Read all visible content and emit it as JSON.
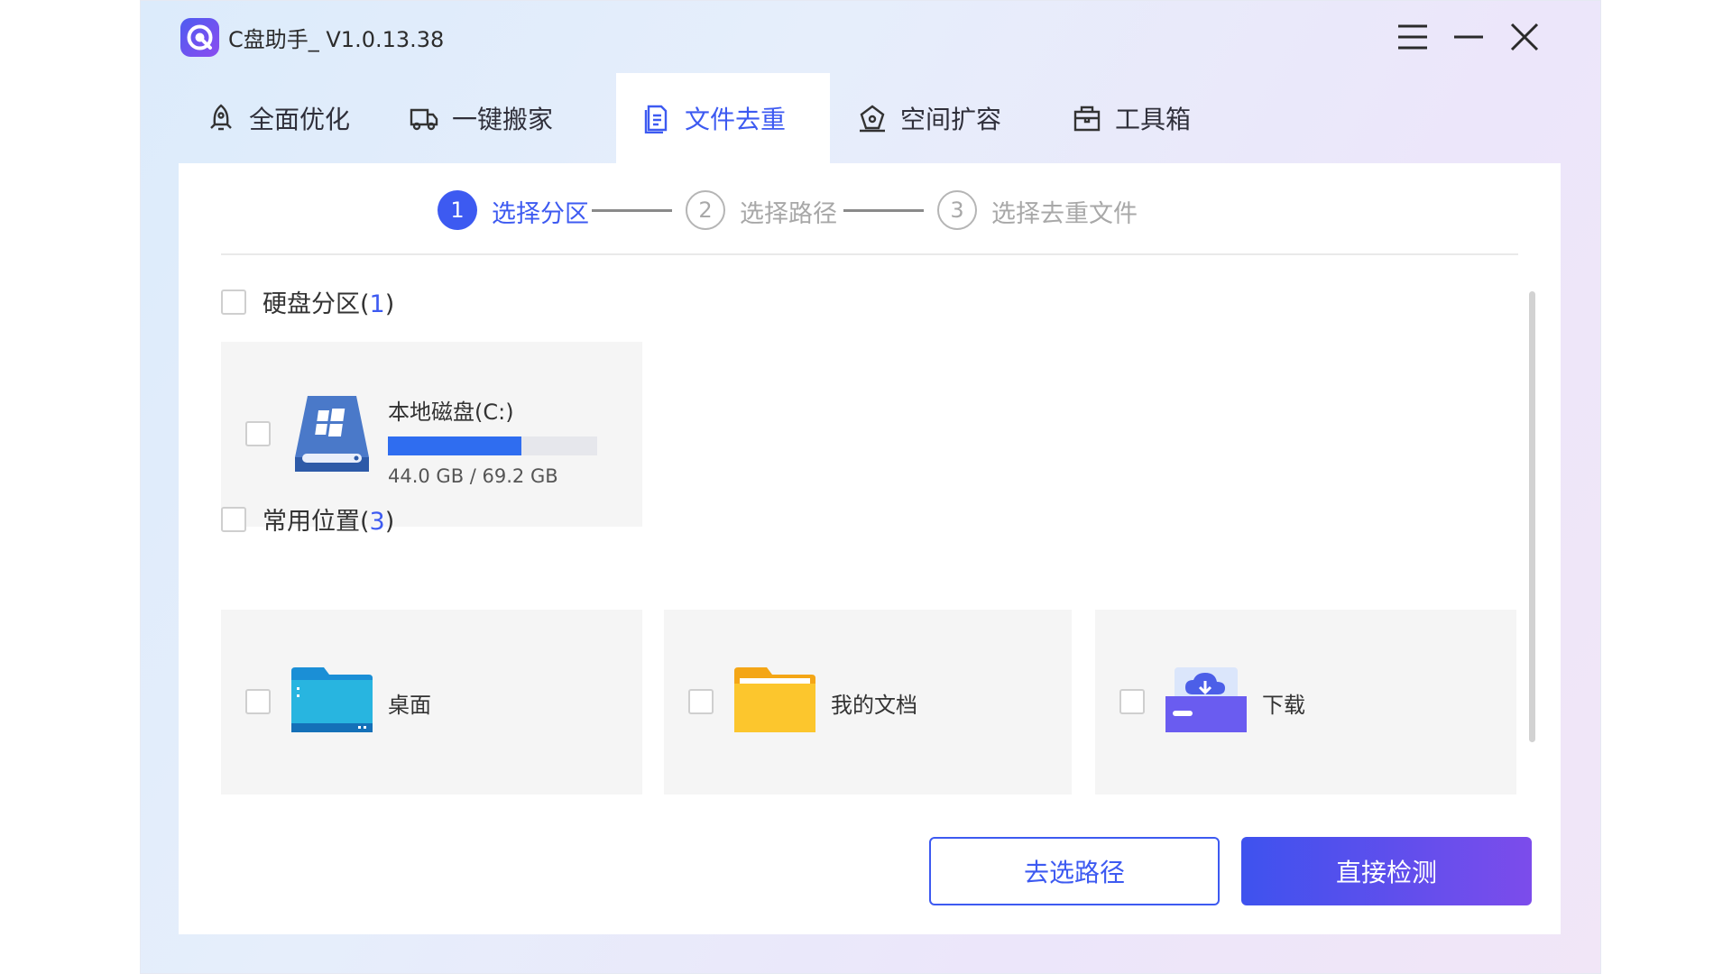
{
  "app": {
    "title": "C盘助手_ V1.0.13.38"
  },
  "tabs": [
    {
      "label": "全面优化",
      "icon": "rocket-icon"
    },
    {
      "label": "一键搬家",
      "icon": "truck-icon"
    },
    {
      "label": "文件去重",
      "icon": "document-icon",
      "active": true
    },
    {
      "label": "空间扩容",
      "icon": "expand-icon"
    },
    {
      "label": "工具箱",
      "icon": "toolbox-icon"
    }
  ],
  "steps": [
    {
      "number": "1",
      "label": "选择分区"
    },
    {
      "number": "2",
      "label": "选择路径"
    },
    {
      "number": "3",
      "label": "选择去重文件"
    }
  ],
  "sections": {
    "disk": {
      "title": "硬盘分区(",
      "count": "1",
      "close": ")"
    },
    "common": {
      "title": "常用位置(",
      "count": "3",
      "close": ")"
    }
  },
  "drive": {
    "name": "本地磁盘(C:)",
    "size_text": "44.0 GB / 69.2 GB",
    "used_fraction": 0.636
  },
  "locations": [
    {
      "label": "桌面",
      "icon": "desktop-folder-icon"
    },
    {
      "label": "我的文档",
      "icon": "documents-folder-icon"
    },
    {
      "label": "下载",
      "icon": "download-icon"
    }
  ],
  "buttons": {
    "select_path": "去选路径",
    "direct_scan": "直接检测"
  },
  "colors": {
    "accent": "#3d5af1",
    "gradient_end": "#7c4ceb",
    "usage_bar": "#2f6df0"
  }
}
